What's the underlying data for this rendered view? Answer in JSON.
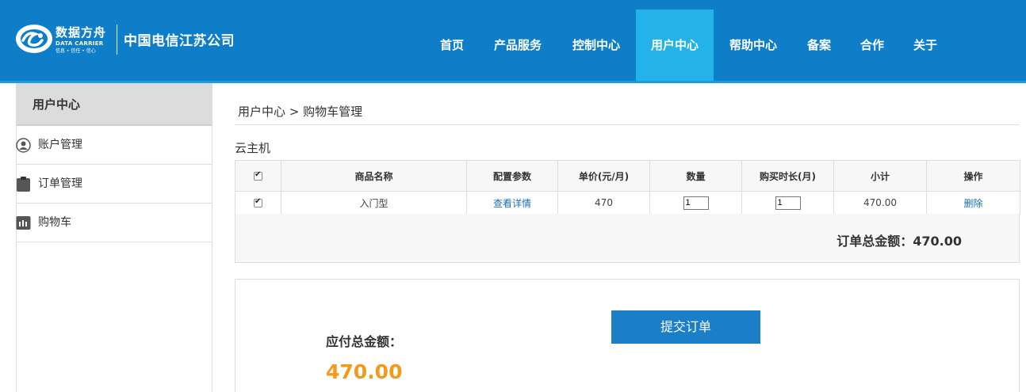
{
  "header": {
    "brand_cn": "数据方舟",
    "brand_en": "DATA CARRIER",
    "brand_slogan": "信息 • 信任 • 信心",
    "company": "中国电信江苏公司",
    "nav": [
      {
        "label": "首页",
        "active": false
      },
      {
        "label": "产品服务",
        "active": false
      },
      {
        "label": "控制中心",
        "active": false
      },
      {
        "label": "用户中心",
        "active": true
      },
      {
        "label": "帮助中心",
        "active": false
      },
      {
        "label": "备案",
        "active": false
      },
      {
        "label": "合作",
        "active": false
      },
      {
        "label": "关于",
        "active": false
      }
    ]
  },
  "sidebar": {
    "title": "用户中心",
    "items": [
      {
        "label": "账户管理",
        "icon": "user-icon"
      },
      {
        "label": "订单管理",
        "icon": "clipboard-icon"
      },
      {
        "label": "购物车",
        "icon": "cart-icon"
      }
    ]
  },
  "breadcrumb": "用户中心 > 购物车管理",
  "section_title": "云主机",
  "table": {
    "headers": [
      "商品名称",
      "配置参数",
      "单价(元/月)",
      "数量",
      "购买时长(月)",
      "小计",
      "操作"
    ],
    "select_all_checked": true,
    "rows": [
      {
        "checked": true,
        "name": "入门型",
        "config_link": "查看详情",
        "price": "470",
        "quantity": "1",
        "duration": "1",
        "subtotal": "470.00",
        "action": "删除"
      }
    ]
  },
  "order_total": "订单总金额：470.00",
  "payment": {
    "label": "应付总金额：",
    "amount": "470.00",
    "submit_label": "提交订单"
  },
  "colors": {
    "header_bg": "#0e7ec8",
    "nav_active_bg": "#24b3e8",
    "link": "#1a6fb5",
    "amount": "#f39a1b",
    "button_bg": "#1a7ec8"
  }
}
